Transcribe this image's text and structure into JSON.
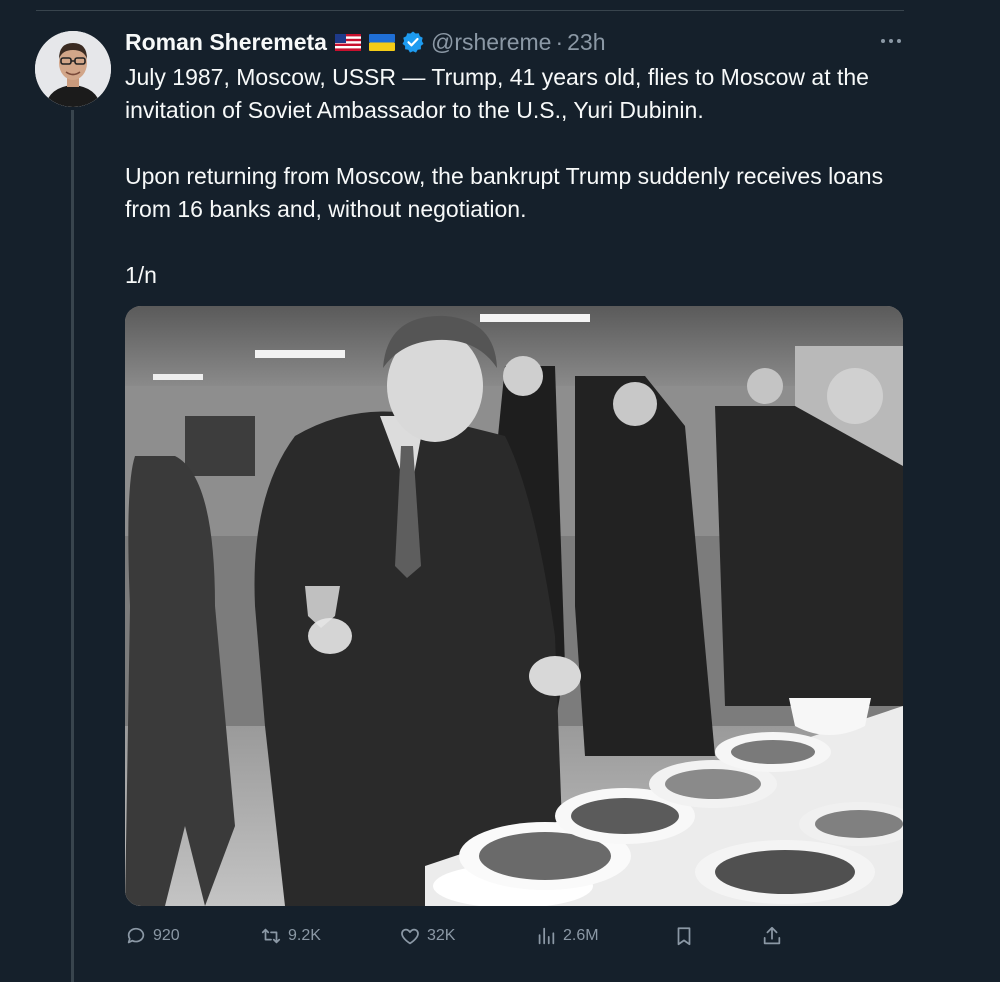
{
  "tweet": {
    "author_name": "Roman Sheremeta",
    "handle": "@rshereme",
    "separator": "·",
    "time": "23h",
    "flags": [
      "us-flag",
      "ukraine-flag"
    ],
    "verified": true,
    "paragraphs": [
      "July 1987, Moscow, USSR — Trump, 41 years old, flies to Moscow at the invitation of Soviet Ambassador to the U.S., Yuri Dubinin.",
      "Upon returning from Moscow, the bankrupt Trump suddenly receives loans from 16 banks and, without negotiation.",
      "1/n"
    ]
  },
  "actions": {
    "replies": "920",
    "retweets": "9.2K",
    "likes": "32K",
    "views": "2.6M"
  },
  "colors": {
    "background": "#15202b",
    "text": "#f7f9f9",
    "secondary": "#8b98a5",
    "accent": "#1d9bf0",
    "divider": "#38444d"
  }
}
